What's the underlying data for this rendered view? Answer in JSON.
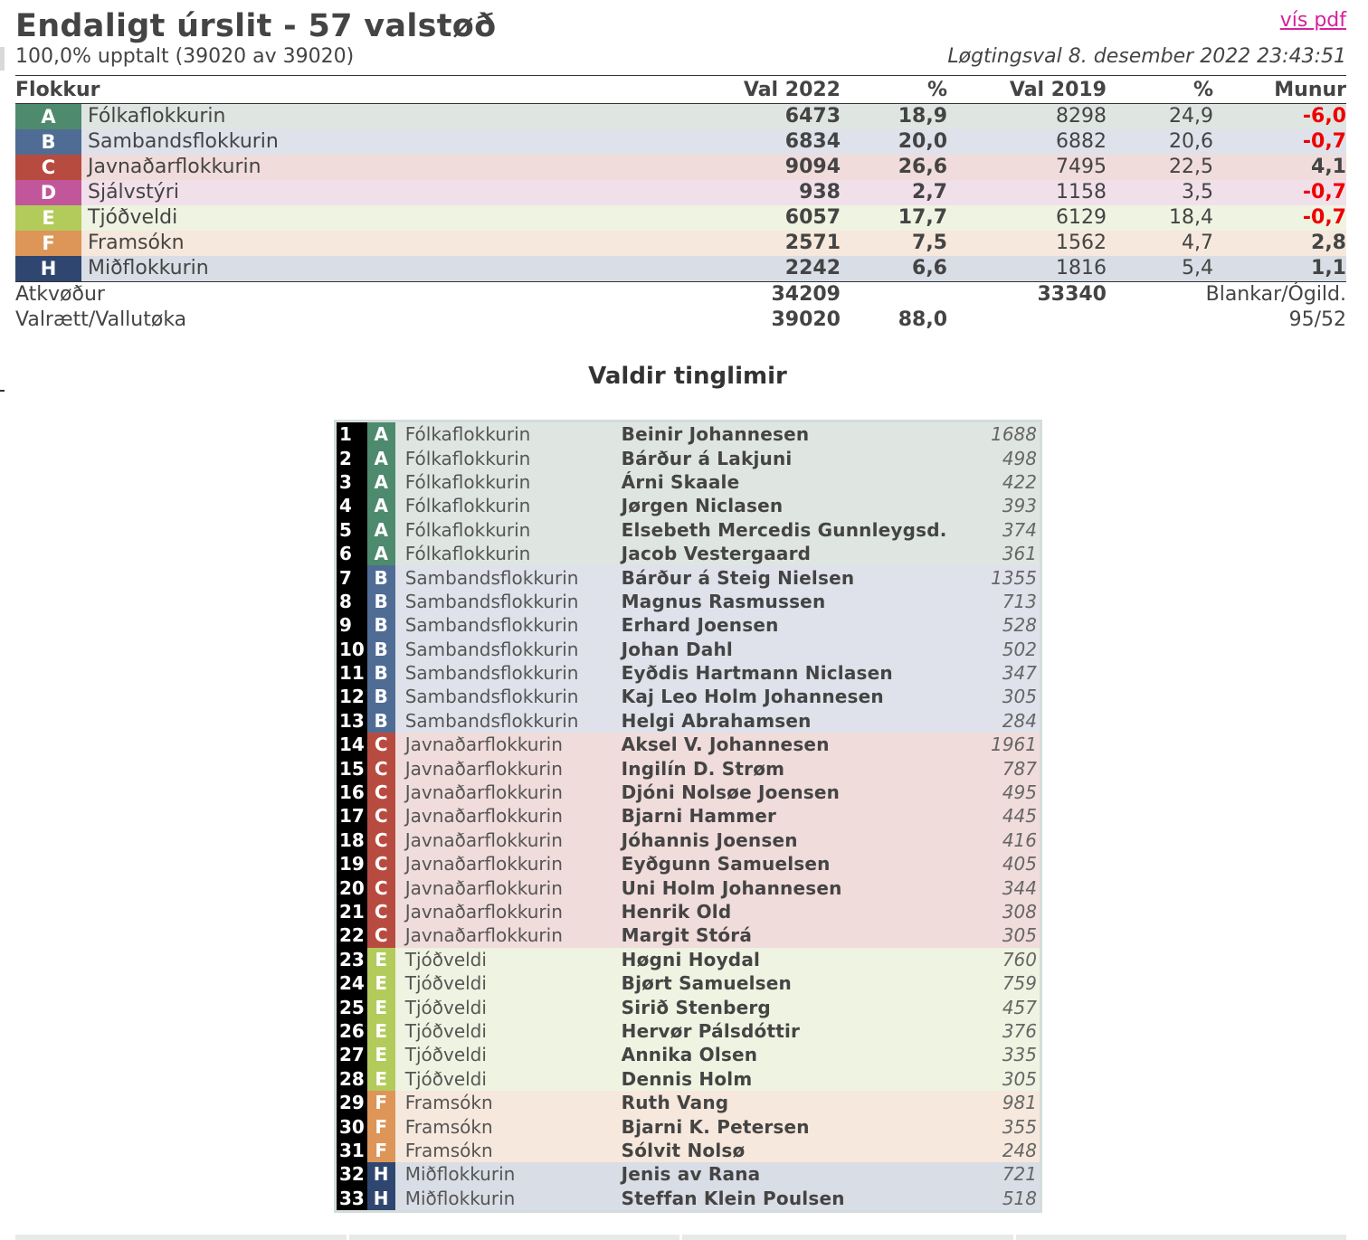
{
  "header": {
    "title": "Endaligt úrslit - 57 valstøð",
    "pdf_link": "vís pdf",
    "counted": "100,0% upptalt (39020 av 39020)",
    "election": "Løgtingsval 8. desember 2022 23:43:51"
  },
  "results": {
    "columns": [
      "Flokkur",
      "Val 2022",
      "%",
      "Val 2019",
      "%",
      "Munur"
    ],
    "rows": [
      {
        "letter": "A",
        "name": "Fólkaflokkurin",
        "val2022": "6473",
        "pct2022": "18,9",
        "val2019": "8298",
        "pct2019": "24,9",
        "diff": "-6,0",
        "color": "#4e8a6e",
        "bg": "#dfe6e2"
      },
      {
        "letter": "B",
        "name": "Sambandsflokkurin",
        "val2022": "6834",
        "pct2022": "20,0",
        "val2019": "6882",
        "pct2019": "20,6",
        "diff": "-0,7",
        "color": "#4f6c95",
        "bg": "#dfe2ea"
      },
      {
        "letter": "C",
        "name": "Javnaðarflokkurin",
        "val2022": "9094",
        "pct2022": "26,6",
        "val2019": "7495",
        "pct2019": "22,5",
        "diff": "4,1",
        "color": "#b84b40",
        "bg": "#f0dcdb"
      },
      {
        "letter": "D",
        "name": "Sjálvstýri",
        "val2022": "938",
        "pct2022": "2,7",
        "val2019": "1158",
        "pct2019": "3,5",
        "diff": "-0,7",
        "color": "#c1569a",
        "bg": "#f1e0ea"
      },
      {
        "letter": "E",
        "name": "Tjóðveldi",
        "val2022": "6057",
        "pct2022": "17,7",
        "val2019": "6129",
        "pct2019": "18,4",
        "diff": "-0,7",
        "color": "#b3cb5b",
        "bg": "#eff3e1"
      },
      {
        "letter": "F",
        "name": "Framsókn",
        "val2022": "2571",
        "pct2022": "7,5",
        "val2019": "1562",
        "pct2019": "4,7",
        "diff": "2,8",
        "color": "#dd9558",
        "bg": "#f6e8dc"
      },
      {
        "letter": "H",
        "name": "Miðflokkurin",
        "val2022": "2242",
        "pct2022": "6,6",
        "val2019": "1816",
        "pct2019": "5,4",
        "diff": "1,1",
        "color": "#2f4770",
        "bg": "#d9dde5"
      }
    ],
    "totals": {
      "votes_label": "Atkvøður",
      "votes_2022": "34209",
      "votes_2019": "33340",
      "blank_label": "Blankar/Ógild.",
      "elig_label": "Valrætt/Vallutøka",
      "elig_2022": "39020",
      "turnout": "88,0",
      "blank_value": "95/52"
    }
  },
  "members": {
    "title": "Valdir tinglimir",
    "rows": [
      {
        "n": "1",
        "letter": "A",
        "party": "Fólkaflokkurin",
        "name": "Beinir Johannesen",
        "votes": "1688"
      },
      {
        "n": "2",
        "letter": "A",
        "party": "Fólkaflokkurin",
        "name": "Bárður á Lakjuni",
        "votes": "498"
      },
      {
        "n": "3",
        "letter": "A",
        "party": "Fólkaflokkurin",
        "name": "Árni Skaale",
        "votes": "422"
      },
      {
        "n": "4",
        "letter": "A",
        "party": "Fólkaflokkurin",
        "name": "Jørgen Niclasen",
        "votes": "393"
      },
      {
        "n": "5",
        "letter": "A",
        "party": "Fólkaflokkurin",
        "name": "Elsebeth Mercedis Gunnleygsd.",
        "votes": "374"
      },
      {
        "n": "6",
        "letter": "A",
        "party": "Fólkaflokkurin",
        "name": "Jacob Vestergaard",
        "votes": "361"
      },
      {
        "n": "7",
        "letter": "B",
        "party": "Sambandsflokkurin",
        "name": "Bárður á Steig Nielsen",
        "votes": "1355"
      },
      {
        "n": "8",
        "letter": "B",
        "party": "Sambandsflokkurin",
        "name": "Magnus Rasmussen",
        "votes": "713"
      },
      {
        "n": "9",
        "letter": "B",
        "party": "Sambandsflokkurin",
        "name": "Erhard Joensen",
        "votes": "528"
      },
      {
        "n": "10",
        "letter": "B",
        "party": "Sambandsflokkurin",
        "name": "Johan Dahl",
        "votes": "502"
      },
      {
        "n": "11",
        "letter": "B",
        "party": "Sambandsflokkurin",
        "name": "Eyðdis Hartmann Niclasen",
        "votes": "347"
      },
      {
        "n": "12",
        "letter": "B",
        "party": "Sambandsflokkurin",
        "name": "Kaj Leo Holm Johannesen",
        "votes": "305"
      },
      {
        "n": "13",
        "letter": "B",
        "party": "Sambandsflokkurin",
        "name": "Helgi Abrahamsen",
        "votes": "284"
      },
      {
        "n": "14",
        "letter": "C",
        "party": "Javnaðarflokkurin",
        "name": "Aksel V. Johannesen",
        "votes": "1961"
      },
      {
        "n": "15",
        "letter": "C",
        "party": "Javnaðarflokkurin",
        "name": "Ingilín D. Strøm",
        "votes": "787"
      },
      {
        "n": "16",
        "letter": "C",
        "party": "Javnaðarflokkurin",
        "name": "Djóni Nolsøe Joensen",
        "votes": "495"
      },
      {
        "n": "17",
        "letter": "C",
        "party": "Javnaðarflokkurin",
        "name": "Bjarni Hammer",
        "votes": "445"
      },
      {
        "n": "18",
        "letter": "C",
        "party": "Javnaðarflokkurin",
        "name": "Jóhannis Joensen",
        "votes": "416"
      },
      {
        "n": "19",
        "letter": "C",
        "party": "Javnaðarflokkurin",
        "name": "Eyðgunn Samuelsen",
        "votes": "405"
      },
      {
        "n": "20",
        "letter": "C",
        "party": "Javnaðarflokkurin",
        "name": "Uni Holm Johannesen",
        "votes": "344"
      },
      {
        "n": "21",
        "letter": "C",
        "party": "Javnaðarflokkurin",
        "name": "Henrik Old",
        "votes": "308"
      },
      {
        "n": "22",
        "letter": "C",
        "party": "Javnaðarflokkurin",
        "name": "Margit Stórá",
        "votes": "305"
      },
      {
        "n": "23",
        "letter": "E",
        "party": "Tjóðveldi",
        "name": "Høgni Hoydal",
        "votes": "760"
      },
      {
        "n": "24",
        "letter": "E",
        "party": "Tjóðveldi",
        "name": "Bjørt Samuelsen",
        "votes": "759"
      },
      {
        "n": "25",
        "letter": "E",
        "party": "Tjóðveldi",
        "name": "Sirið Stenberg",
        "votes": "457"
      },
      {
        "n": "26",
        "letter": "E",
        "party": "Tjóðveldi",
        "name": "Hervør Pálsdóttir",
        "votes": "376"
      },
      {
        "n": "27",
        "letter": "E",
        "party": "Tjóðveldi",
        "name": "Annika Olsen",
        "votes": "335"
      },
      {
        "n": "28",
        "letter": "E",
        "party": "Tjóðveldi",
        "name": "Dennis Holm",
        "votes": "305"
      },
      {
        "n": "29",
        "letter": "F",
        "party": "Framsókn",
        "name": "Ruth Vang",
        "votes": "981"
      },
      {
        "n": "30",
        "letter": "F",
        "party": "Framsókn",
        "name": "Bjarni K. Petersen",
        "votes": "355"
      },
      {
        "n": "31",
        "letter": "F",
        "party": "Framsókn",
        "name": "Sólvit Nolsø",
        "votes": "248"
      },
      {
        "n": "32",
        "letter": "H",
        "party": "Miðflokkurin",
        "name": "Jenis av Rana",
        "votes": "721"
      },
      {
        "n": "33",
        "letter": "H",
        "party": "Miðflokkurin",
        "name": "Steffan Klein Poulsen",
        "votes": "518"
      }
    ]
  }
}
